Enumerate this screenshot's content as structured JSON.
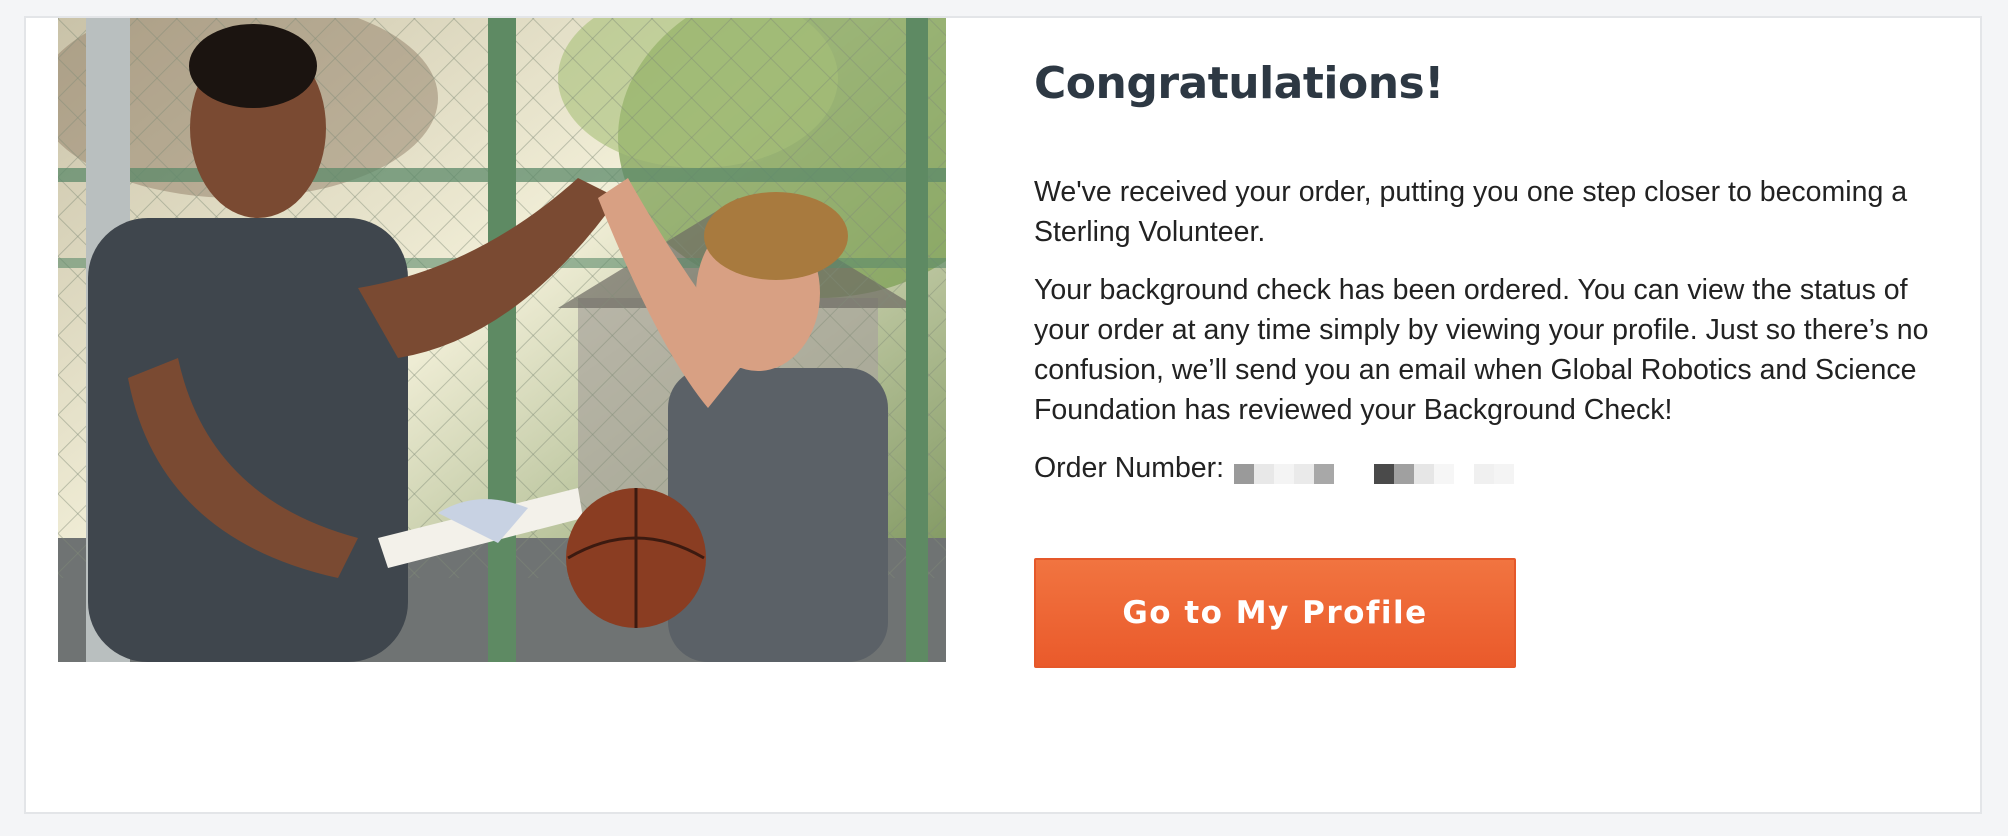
{
  "hero_image": {
    "description_icon": "volunteer-high-five-photo"
  },
  "content": {
    "title": "Congratulations!",
    "paragraph_1": "We've received your order, putting you one step closer to becoming a Sterling Volunteer.",
    "paragraph_2": "Your background check has been ordered. You can view the status of your order at any time simply by viewing your profile. Just so there’s no confusion, we’ll send you an email when Global Robotics and Science Foundation has reviewed your Background Check!",
    "order_label": "Order Number:",
    "order_number_redacted": true
  },
  "button": {
    "label": "Go to My Profile"
  },
  "colors": {
    "accent": "#ec6232",
    "title": "#2d3843",
    "text": "#222222",
    "background": "#f4f5f7"
  }
}
